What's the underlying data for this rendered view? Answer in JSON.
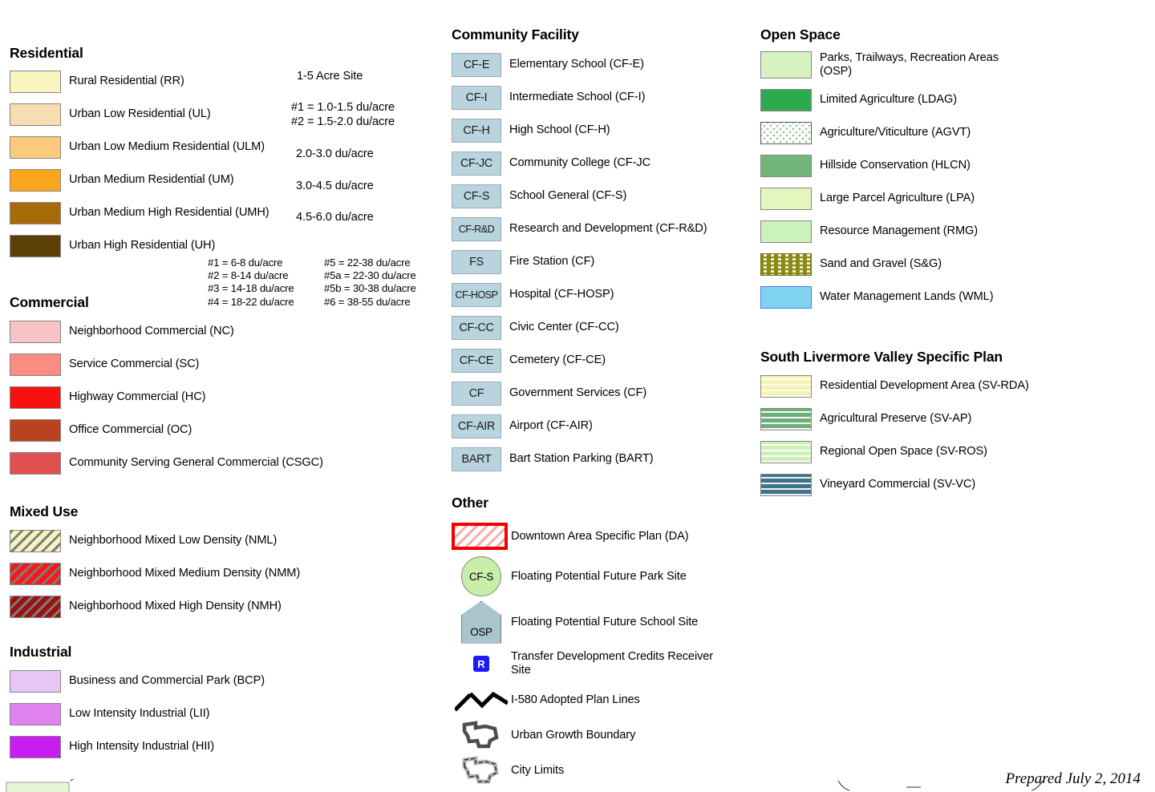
{
  "document": {
    "prepared": "Prepared July 2, 2014"
  },
  "residential": {
    "heading": "Residential",
    "items": [
      {
        "label": "Rural Residential (RR)",
        "color": "#faf5bf",
        "code": "RR"
      },
      {
        "label": "Urban Low Residential (UL)",
        "color": "#f7ddaf",
        "code": "UL"
      },
      {
        "label": "Urban Low Medium Residential (ULM)",
        "color": "#fbcb7d",
        "code": "ULM"
      },
      {
        "label": "Urban Medium Residential (UM)",
        "color": "#fba51c",
        "code": "UM"
      },
      {
        "label": "Urban Medium High Residential (UMH)",
        "color": "#a76a08",
        "code": "UMH"
      },
      {
        "label": "Urban High Residential (UH)",
        "color": "#5c4008",
        "code": "UH"
      }
    ],
    "density_notes": {
      "acre_site": "1-5 Acre Site",
      "ul_lines": "#1 = 1.0-1.5 du/acre\n#2 = 1.5-2.0 du/acre",
      "ulm": "2.0-3.0 du/acre",
      "um": "3.0-4.5 du/acre",
      "umh": "4.5-6.0 du/acre",
      "uh_col1": "#1 = 6-8 du/acre\n#2 = 8-14 du/acre\n#3 = 14-18 du/acre\n#4 = 18-22 du/acre",
      "uh_col2": "#5 = 22-38 du/acre\n#5a = 22-30 du/acre\n#5b = 30-38 du/acre\n#6 = 38-55 du/acre"
    }
  },
  "commercial": {
    "heading": "Commercial",
    "items": [
      {
        "label": "Neighborhood Commercial (NC)",
        "color": "#fac3c3"
      },
      {
        "label": "Service Commercial (SC)",
        "color": "#fa8c82"
      },
      {
        "label": "Highway Commercial (HC)",
        "color": "#f81111"
      },
      {
        "label": "Office Commercial (OC)",
        "color": "#b8431e"
      },
      {
        "label": "Community Serving General Commercial (CSGC)",
        "color": "#e05050"
      }
    ]
  },
  "mixed_use": {
    "heading": "Mixed Use",
    "items": [
      {
        "label": "Neighborhood Mixed Low Density (NML)",
        "pattern": "hatch-nml"
      },
      {
        "label": "Neighborhood Mixed Medium Density (NMM)",
        "pattern": "hatch-nmm"
      },
      {
        "label": "Neighborhood Mixed High Density (NMH)",
        "pattern": "hatch-nmh"
      }
    ]
  },
  "industrial": {
    "heading": "Industrial",
    "items": [
      {
        "label": "Business and Commercial Park (BCP)",
        "color": "#e6c6f5"
      },
      {
        "label": "Low Intensity Industrial (LII)",
        "color": "#e082f0"
      },
      {
        "label": "High Intensity Industrial (HII)",
        "color": "#c81ef0"
      }
    ]
  },
  "community_facility": {
    "heading": "Community Facility",
    "swatch_color": "#b9d4de",
    "items": [
      {
        "code": "CF-E",
        "label": "Elementary School (CF-E)"
      },
      {
        "code": "CF-I",
        "label": "Intermediate School (CF-I)"
      },
      {
        "code": "CF-H",
        "label": "High School (CF-H)"
      },
      {
        "code": "CF-JC",
        "label": "Community College (CF-JC"
      },
      {
        "code": "CF-S",
        "label": "School General (CF-S)"
      },
      {
        "code": "CF-R&D",
        "label": "Research and Development (CF-R&D)"
      },
      {
        "code": "FS",
        "label": "Fire Station (CF)"
      },
      {
        "code": "CF-HOSP",
        "label": "Hospital (CF-HOSP)"
      },
      {
        "code": "CF-CC",
        "label": "Civic Center (CF-CC)"
      },
      {
        "code": "CF-CE",
        "label": "Cemetery (CF-CE)"
      },
      {
        "code": "CF",
        "label": "Government Services (CF)"
      },
      {
        "code": "CF-AIR",
        "label": "Airport (CF-AIR)"
      },
      {
        "code": "BART",
        "label": "Bart Station Parking (BART)"
      }
    ]
  },
  "other": {
    "heading": "Other",
    "items": [
      {
        "icon": "downtown-area-swatch",
        "label": "Downtown Area Specific Plan (DA)"
      },
      {
        "icon": "park-site-circle",
        "code": "CF-S",
        "label": "Floating Potential Future Park Site"
      },
      {
        "icon": "school-site-pentagon",
        "code": "OSP",
        "label": "Floating Potential Future School Site"
      },
      {
        "icon": "tdc-receiver-marker",
        "code": "R",
        "label": "Transfer Development Credits Receiver\nSite"
      },
      {
        "icon": "plan-lines-dashed",
        "label": "I-580 Adopted Plan Lines"
      },
      {
        "icon": "urban-growth-boundary",
        "label": "Urban Growth Boundary"
      },
      {
        "icon": "city-limits",
        "label": "City Limits"
      }
    ]
  },
  "open_space": {
    "heading": "Open Space",
    "items": [
      {
        "label": "Parks, Trailways, Recreation Areas\n(OSP)",
        "color": "#d5f2c0"
      },
      {
        "label": "Limited Agriculture (LDAG)",
        "color": "#2bab4d"
      },
      {
        "label": "Agriculture/Viticulture (AGVT)",
        "pattern": "dots-agvt"
      },
      {
        "label": "Hillside Conservation (HLCN)",
        "color": "#74b57a"
      },
      {
        "label": "Large Parcel Agriculture (LPA)",
        "color": "#e4f5bd"
      },
      {
        "label": "Resource Management (RMG)",
        "color": "#ccf2bc"
      },
      {
        "label": "Sand and Gravel (S&G)",
        "pattern": "sand"
      },
      {
        "label": "Water Management Lands (WML)",
        "color": "#80d4f2"
      }
    ]
  },
  "south_livermore": {
    "heading": "South Livermore Valley Specific Plan",
    "items": [
      {
        "label": "Residential Development Area (SV-RDA)",
        "color": "#f6f2b2"
      },
      {
        "label": "Agricultural Preserve (SV-AP)",
        "color": "#6fb07a"
      },
      {
        "label": "Regional Open Space (SV-ROS)",
        "color": "#cdf0b8"
      },
      {
        "label": "Vineyard Commercial (SV-VC)",
        "color": "#3f7386"
      }
    ]
  }
}
